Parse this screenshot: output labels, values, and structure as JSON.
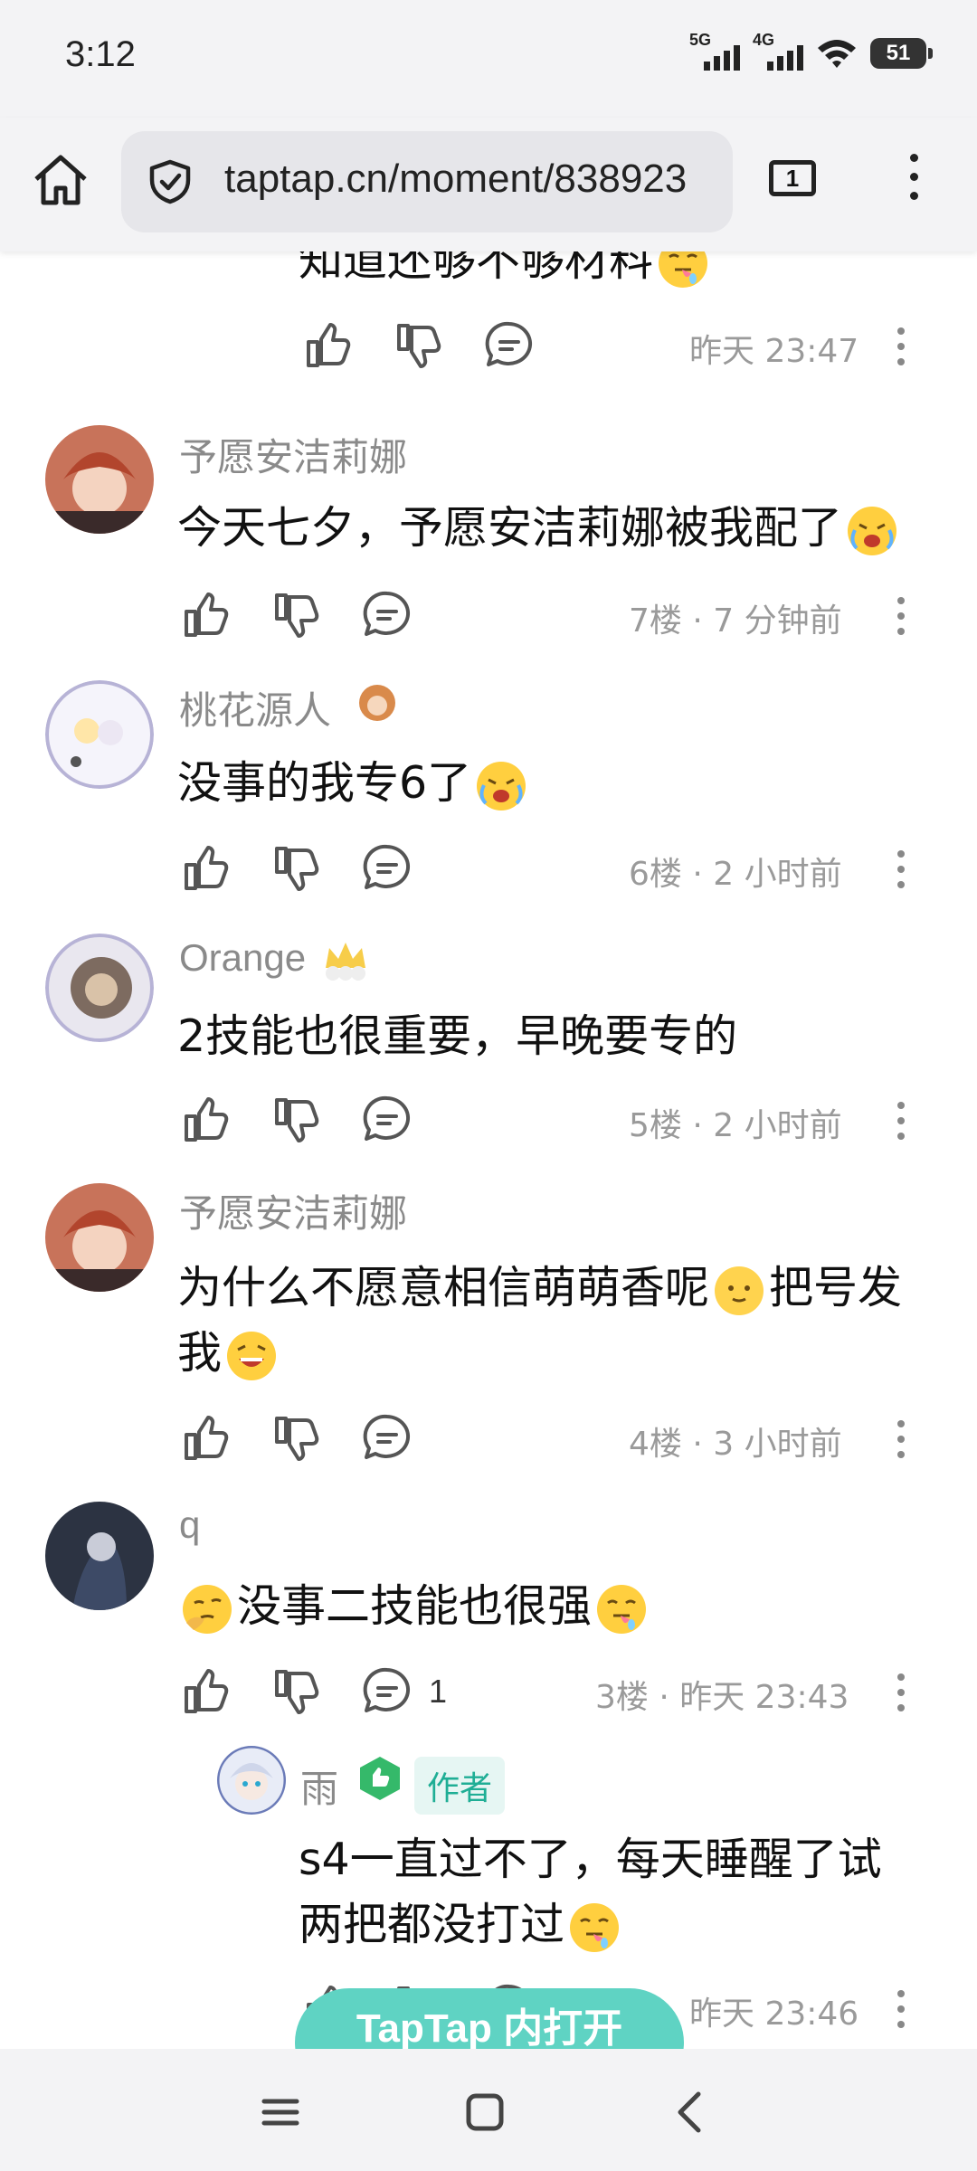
{
  "status_bar": {
    "time": "3:12",
    "signal1_label": "5G",
    "signal2_label": "4G",
    "battery": "51"
  },
  "browser": {
    "url": "taptap.cn/moment/838923",
    "tab_count": "1"
  },
  "comments": [
    {
      "text": "知道还够不够材料",
      "meta": "昨天 23:47"
    },
    {
      "username": "予愿安洁莉娜",
      "text": "今天七夕，予愿安洁莉娜被我配了",
      "meta": "7楼 · 7 分钟前"
    },
    {
      "username": "桃花源人",
      "text": "没事的我专6了",
      "meta": "6楼 · 2 小时前"
    },
    {
      "username": "Orange",
      "text": "2技能也很重要，早晚要专的",
      "meta": "5楼 · 2 小时前"
    },
    {
      "username": "予愿安洁莉娜",
      "text_line1a": "为什么不愿意相信萌萌香呢",
      "text_line1b": "把号发",
      "text_line2": "我",
      "meta": "4楼 · 3 小时前"
    },
    {
      "username": "q",
      "text": "没事二技能也很强",
      "reply_count": "1",
      "meta": "3楼 · 昨天 23:43"
    }
  ],
  "reply": {
    "username": "雨",
    "author_badge": "作者",
    "line1": "s4一直过不了，每天睡醒了试",
    "line2": "两把都没打过",
    "meta": "昨天 23:46"
  },
  "open_app_button": "TapTap 内打开",
  "colors": {
    "accent": "#5fd3c3",
    "author_badge_text": "#1fae95",
    "meta_text": "#9a9a9a"
  },
  "icons": [
    "home-icon",
    "shield-icon",
    "tabs-icon",
    "menu-icon",
    "like-icon",
    "dislike-icon",
    "reply-icon",
    "more-icon",
    "recents-icon",
    "home-nav-icon",
    "back-icon"
  ]
}
